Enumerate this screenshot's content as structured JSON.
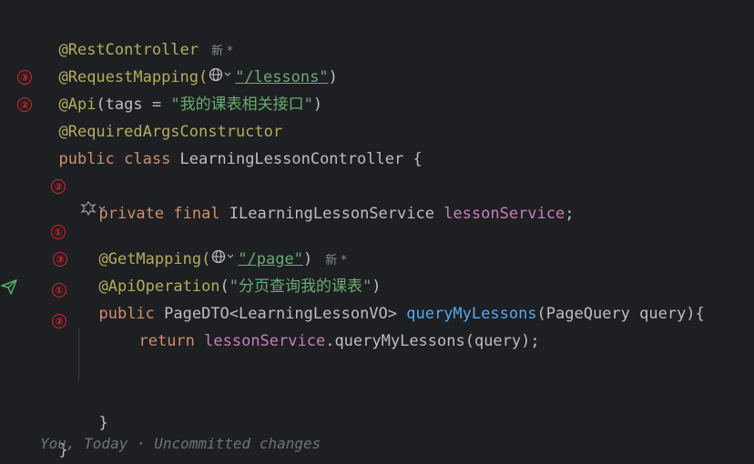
{
  "code": {
    "l1_ann": "@RestController",
    "l1_meta": "新 *",
    "l2_ann": "@RequestMapping(",
    "l2_str": "\"/lessons\"",
    "l2_close": ")",
    "l3_ann": "@Api",
    "l3_mid": "(tags = ",
    "l3_str": "\"我的课表相关接口\"",
    "l3_close": ")",
    "l4_ann": "@RequiredArgsConstructor",
    "l5_kw": "public class ",
    "l5_name": "LearningLessonController {",
    "l7_kw": "private final ",
    "l7_type": "ILearningLessonService ",
    "l7_field": "lessonService",
    "l7_end": ";",
    "l9_ann": "@GetMapping(",
    "l9_str": "\"/page\"",
    "l9_close": ")",
    "l9_meta": "新 *",
    "l10_ann": "@ApiOperation",
    "l10_open": "(",
    "l10_str": "\"分页查询我的课表\"",
    "l10_close": ")",
    "l11_kw": "public ",
    "l11_type": "PageDTO<LearningLessonVO> ",
    "l11_meth": "queryMyLessons",
    "l11_rest": "(PageQuery query){",
    "l12_kw": "return ",
    "l12_field": "lessonService",
    "l12_rest": ".queryMyLessons(query);",
    "l15_close": "}",
    "l16_close": "}",
    "blame": "You, Today · Uncommitted changes"
  },
  "markers": [
    "③",
    "②",
    "②",
    "①",
    "③",
    "①",
    "②"
  ],
  "colors": {
    "background": "#1e1f22",
    "annotation": "#b3ae60",
    "string": "#6aab73",
    "keyword": "#cf8e6d",
    "field": "#c77dbb",
    "method": "#56a8f5",
    "marker": "#e02525"
  }
}
